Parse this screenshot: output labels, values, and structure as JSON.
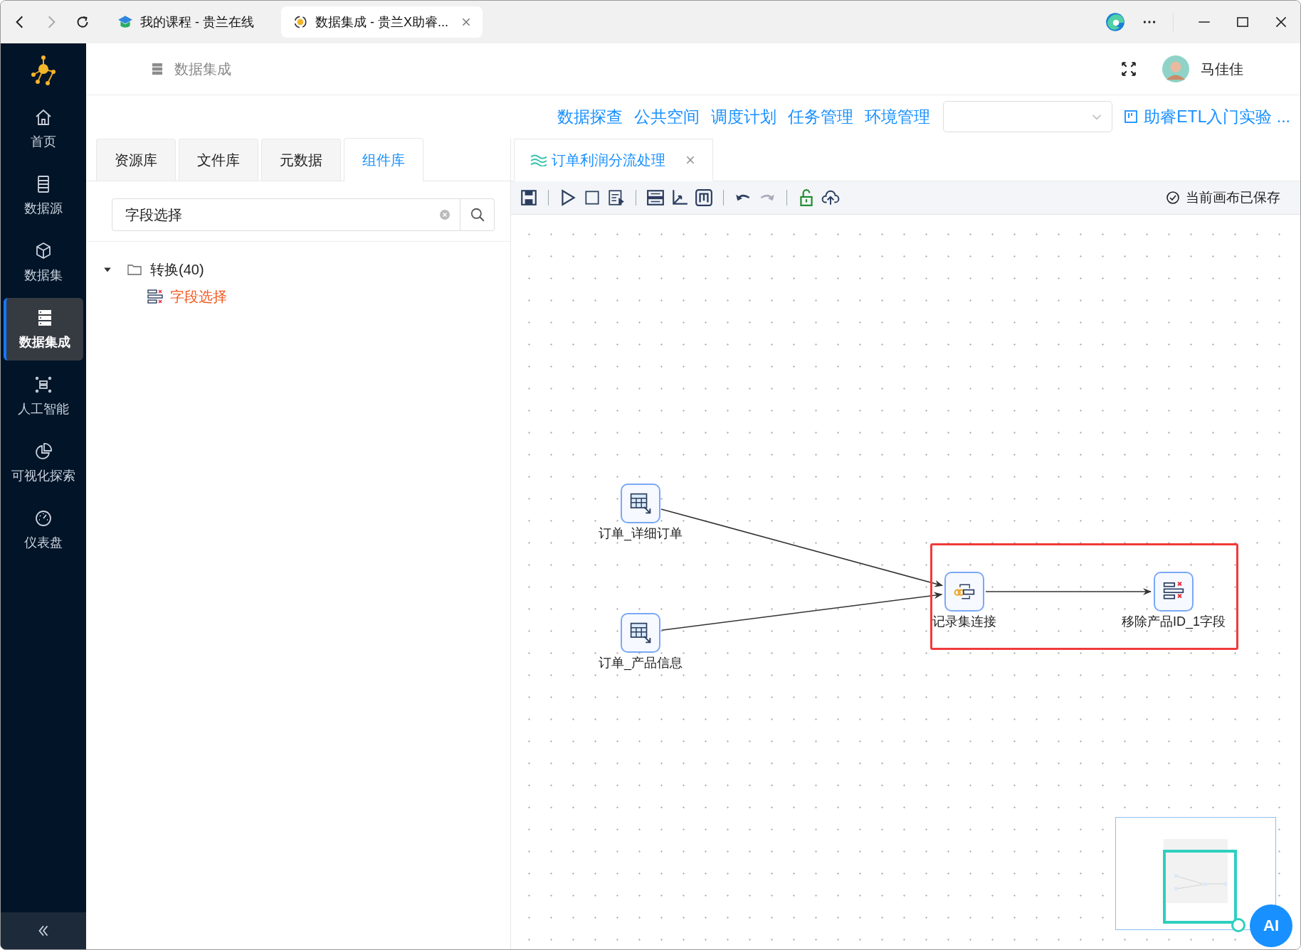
{
  "browser": {
    "tabs": [
      {
        "title": "我的课程 - 贵兰在线",
        "selected": false
      },
      {
        "title": "数据集成 - 贵兰X助睿...",
        "selected": true
      }
    ]
  },
  "sidebar": {
    "items": [
      {
        "label": "首页",
        "selected": false
      },
      {
        "label": "数据源",
        "selected": false
      },
      {
        "label": "数据集",
        "selected": false
      },
      {
        "label": "数据集成",
        "selected": true
      },
      {
        "label": "人工智能",
        "selected": false
      },
      {
        "label": "可视化探索",
        "selected": false
      },
      {
        "label": "仪表盘",
        "selected": false
      }
    ]
  },
  "header": {
    "title": "数据集成",
    "user": "马佳佳"
  },
  "nav": {
    "links": [
      "数据探查",
      "公共空间",
      "调度计划",
      "任务管理",
      "环境管理"
    ],
    "project": "助睿ETL入门实验 ..."
  },
  "library": {
    "tabs": [
      {
        "label": "资源库",
        "selected": false
      },
      {
        "label": "文件库",
        "selected": false
      },
      {
        "label": "元数据",
        "selected": false
      },
      {
        "label": "组件库",
        "selected": true
      }
    ],
    "search": {
      "value": "字段选择"
    },
    "tree": [
      {
        "label": "转换(40)",
        "expanded": true,
        "children": [
          {
            "label": "字段选择",
            "selected": true
          }
        ]
      }
    ]
  },
  "editor": {
    "tab": "订单利润分流处理",
    "status": "当前画布已保存",
    "highlight_frame": true,
    "nodes": [
      {
        "label": "订单_详细订单",
        "kind": "table-input"
      },
      {
        "label": "订单_产品信息",
        "kind": "table-input"
      },
      {
        "label": "记录集连接",
        "kind": "join"
      },
      {
        "label": "移除产品ID_1字段",
        "kind": "select-fields"
      }
    ],
    "ai_button": "AI"
  }
}
